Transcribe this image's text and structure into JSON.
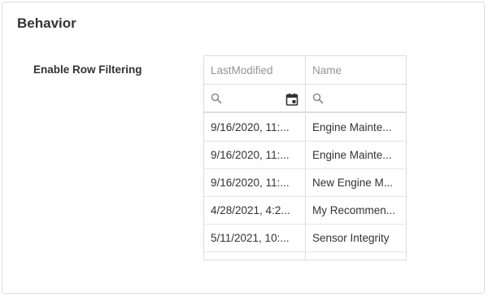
{
  "panel": {
    "title": "Behavior"
  },
  "setting": {
    "label": "Enable Row Filtering"
  },
  "grid": {
    "columns": [
      {
        "label": "LastModified"
      },
      {
        "label": "Name"
      }
    ],
    "filters": {
      "lastmodified_value": "",
      "name_value": ""
    },
    "rows": [
      {
        "last_modified": "9/16/2020, 11:...",
        "name": "Engine Mainte..."
      },
      {
        "last_modified": "9/16/2020, 11:...",
        "name": "Engine Mainte..."
      },
      {
        "last_modified": "9/16/2020, 11:...",
        "name": "New Engine M..."
      },
      {
        "last_modified": "4/28/2021, 4:2...",
        "name": "My Recommen..."
      },
      {
        "last_modified": "5/11/2021, 10:...",
        "name": "Sensor Integrity"
      }
    ]
  },
  "icons": {
    "filter_search": "search-icon",
    "date_picker": "calendar-icon"
  },
  "colors": {
    "header_text": "#959595",
    "border": "#dddddd",
    "text": "#333333"
  }
}
